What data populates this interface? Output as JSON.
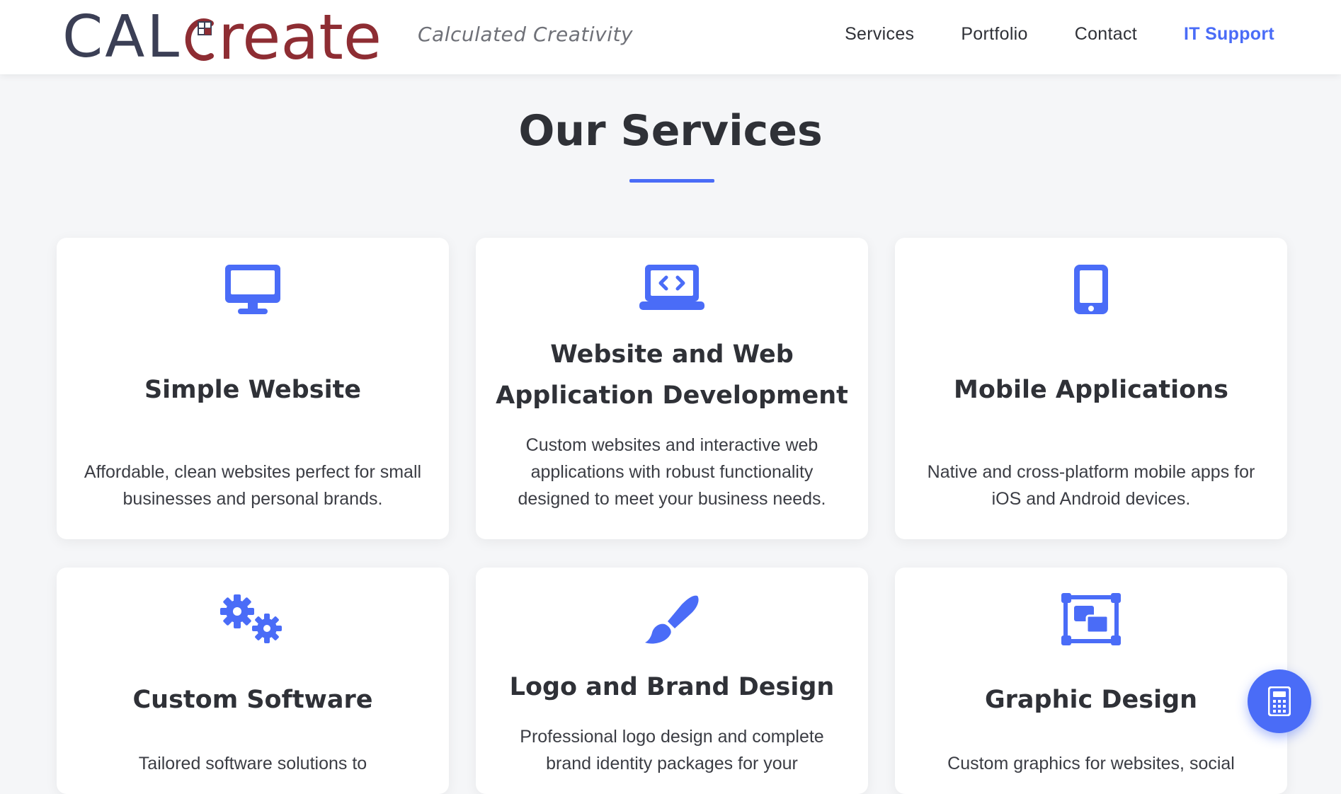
{
  "header": {
    "logo_part1": "CAL",
    "logo_part2": "reate",
    "tagline": "Calculated Creativity",
    "nav": [
      {
        "label": "Services"
      },
      {
        "label": "Portfolio"
      },
      {
        "label": "Contact"
      },
      {
        "label": "IT Support"
      }
    ]
  },
  "main": {
    "title": "Our Services",
    "services": [
      {
        "icon": "desktop-icon",
        "title_line1": "Simple Website",
        "title_line2": "",
        "description": "Affordable, clean websites perfect for small businesses and personal brands."
      },
      {
        "icon": "laptop-code-icon",
        "title_line1": "Website and Web",
        "title_line2": "Application Development",
        "description": "Custom websites and interactive web applications with robust functionality designed to meet your business needs."
      },
      {
        "icon": "mobile-icon",
        "title_line1": "Mobile Applications",
        "title_line2": "",
        "description": "Native and cross-platform mobile apps for iOS and Android devices."
      },
      {
        "icon": "gears-icon",
        "title_line1": "Custom Software",
        "title_line2": "",
        "description": "Tailored software solutions to"
      },
      {
        "icon": "paintbrush-icon",
        "title_line1": "Logo and Brand Design",
        "title_line2": "",
        "description": "Professional logo design and complete brand identity packages for your"
      },
      {
        "icon": "object-group-icon",
        "title_line1": "Graphic Design",
        "title_line2": "",
        "description": "Custom graphics for websites, social"
      }
    ]
  },
  "fab": {
    "icon": "calculator-icon"
  },
  "colors": {
    "accent": "#4a6cf7",
    "logo_dark": "#3b3f55",
    "logo_red": "#8e2d33",
    "background": "#f5f6f8"
  }
}
